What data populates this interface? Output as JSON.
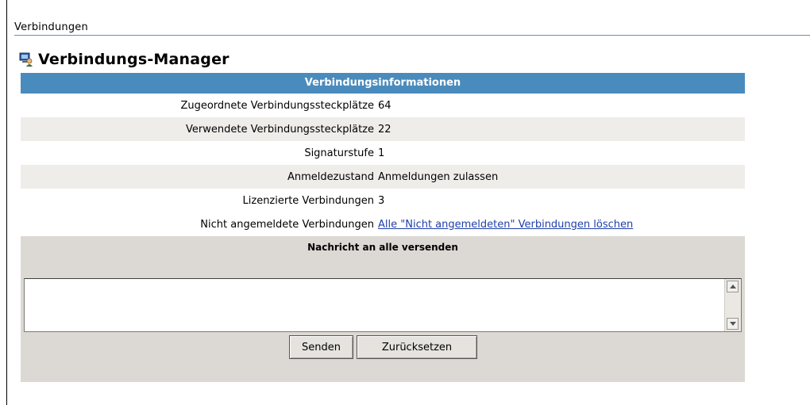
{
  "page": {
    "section_title": "Verbindungen"
  },
  "header": {
    "title": "Verbindungs-Manager",
    "icon": "computer-user-icon"
  },
  "panel": {
    "title": "Verbindungsinformationen",
    "rows": [
      {
        "label": "Zugeordnete Verbindungssteckplätze",
        "value": "64"
      },
      {
        "label": "Verwendete Verbindungssteckplätze",
        "value": "22"
      },
      {
        "label": "Signaturstufe",
        "value": "1"
      },
      {
        "label": "Anmeldezustand",
        "value": "Anmeldungen zulassen"
      },
      {
        "label": "Lizenzierte Verbindungen",
        "value": "3"
      },
      {
        "label": "Nicht angemeldete Verbindungen",
        "link": "Alle \"Nicht angemeldeten\" Verbindungen löschen"
      }
    ]
  },
  "message": {
    "title": "Nachricht an alle versenden",
    "text": "",
    "send_label": "Senden",
    "reset_label": "Zurücksetzen"
  },
  "colors": {
    "header_blue": "#4a8bbd",
    "row_shade": "#efedea",
    "message_bg": "#dcd8d3",
    "link": "#1f3fa8"
  }
}
